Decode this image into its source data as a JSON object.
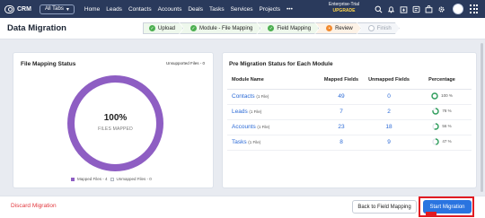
{
  "topbar": {
    "app_name": "CRM",
    "tabs_dropdown": "All Tabs",
    "nav_items": [
      "Home",
      "Leads",
      "Contacts",
      "Accounts",
      "Deals",
      "Tasks",
      "Services",
      "Projects",
      "•••"
    ],
    "trial_label": "Enterprise-Trial",
    "upgrade_label": "UPGRADE"
  },
  "page": {
    "title": "Data Migration"
  },
  "steps": [
    {
      "label": "Upload",
      "status": "done"
    },
    {
      "label": "Module - File Mapping",
      "status": "done"
    },
    {
      "label": "Field Mapping",
      "status": "done"
    },
    {
      "label": "Review",
      "status": "current"
    },
    {
      "label": "Finish",
      "status": "pending"
    }
  ],
  "file_mapping": {
    "title": "File Mapping Status",
    "unsupported": "Unsupported Files - 0",
    "percent_label": "100%",
    "percent_value": 100,
    "center_label": "FILES MAPPED",
    "legend_mapped": "Mapped Files - 4",
    "legend_unmapped": "Unmapped Files - 0",
    "color": "#8e5ec3"
  },
  "pre_migration": {
    "title": "Pre Migration Status for Each Module",
    "headers": {
      "module": "Module Name",
      "mapped": "Mapped Fields",
      "unmapped": "Unmapped Fields",
      "percentage": "Percentage"
    },
    "rows": [
      {
        "name": "Contacts",
        "files": "(1 File)",
        "mapped": "49",
        "unmapped": "0",
        "percent": "100 %",
        "value": 100
      },
      {
        "name": "Leads",
        "files": "(1 File)",
        "mapped": "7",
        "unmapped": "2",
        "percent": "78 %",
        "value": 78
      },
      {
        "name": "Accounts",
        "files": "(1 File)",
        "mapped": "23",
        "unmapped": "18",
        "percent": "56 %",
        "value": 56
      },
      {
        "name": "Tasks",
        "files": "(1 File)",
        "mapped": "8",
        "unmapped": "9",
        "percent": "47 %",
        "value": 47
      }
    ]
  },
  "footer": {
    "discard_label": "Discard Migration",
    "back_label": "Back to Field Mapping",
    "start_label": "Start Migration"
  },
  "colors": {
    "accent": "#2a74e0",
    "nav_bg": "#2a3a5c",
    "success": "#4caf50",
    "current": "#f28b30",
    "danger": "#e2383e"
  }
}
